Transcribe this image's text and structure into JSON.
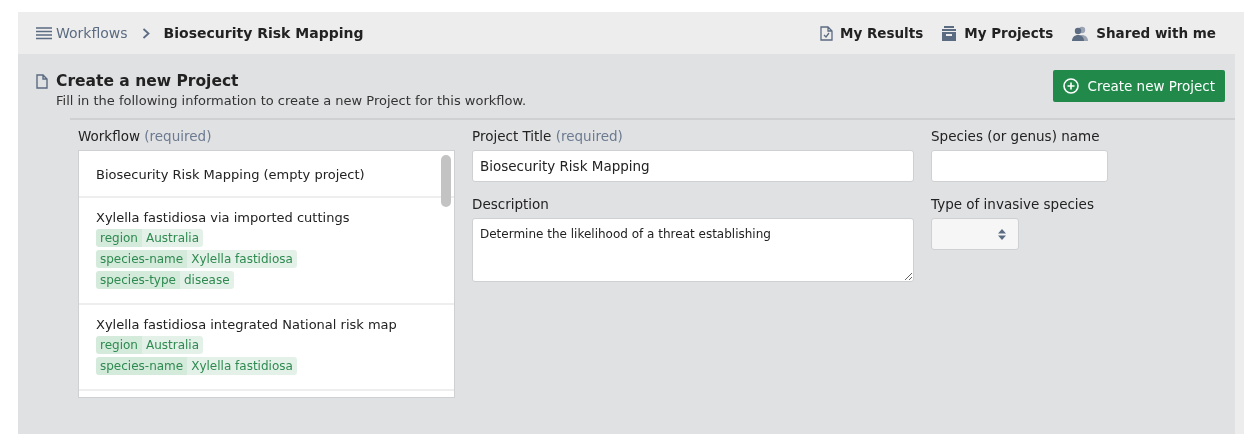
{
  "breadcrumb": {
    "parent": "Workflows",
    "current": "Biosecurity Risk Mapping"
  },
  "nav_links": [
    {
      "label": "My Results",
      "kind": "results"
    },
    {
      "label": "My Projects",
      "kind": "projects"
    },
    {
      "label": "Shared with me",
      "kind": "shared"
    }
  ],
  "panel": {
    "title": "Create a new Project",
    "subtitle": "Fill in the following information to create a new Project for this workflow.",
    "create_button": "Create new Project"
  },
  "workflow_field": {
    "label": "Workflow",
    "hint": "(required)",
    "items": [
      {
        "title": "Biosecurity Risk Mapping (empty project)"
      },
      {
        "title": "Xylella fastidiosa via imported cuttings",
        "tags": [
          {
            "key": "region",
            "value": "Australia"
          },
          {
            "key": "species-name",
            "value": "Xylella fastidiosa"
          },
          {
            "key": "species-type",
            "value": "disease"
          }
        ]
      },
      {
        "title": "Xylella fastidiosa integrated National risk map",
        "tags": [
          {
            "key": "region",
            "value": "Australia"
          },
          {
            "key": "species-name",
            "value": "Xylella fastidiosa"
          }
        ]
      }
    ]
  },
  "project_title": {
    "label": "Project Title",
    "hint": "(required)",
    "value": "Biosecurity Risk Mapping"
  },
  "description": {
    "label": "Description",
    "value": "Determine the likelihood of a threat establishing"
  },
  "species_name": {
    "label": "Species (or genus) name"
  },
  "species_type": {
    "label": "Type of invasive species"
  }
}
